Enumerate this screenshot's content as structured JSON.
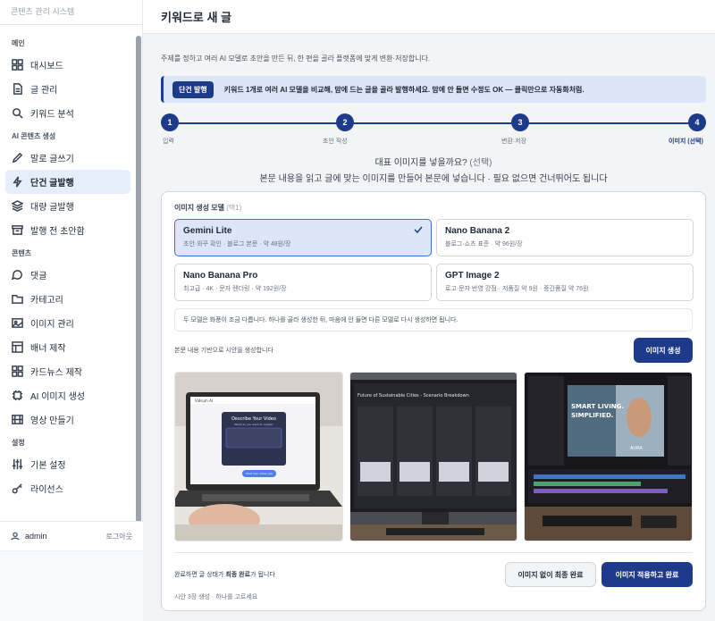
{
  "sidebar": {
    "app_name": "콘텐츠 관리 시스템",
    "sections": [
      {
        "title": "메인",
        "items": [
          {
            "label": "대시보드",
            "icon": "grid-icon"
          },
          {
            "label": "글 관리",
            "icon": "document-icon"
          },
          {
            "label": "키워드 분석",
            "icon": "search-icon"
          }
        ]
      },
      {
        "title": "AI 콘텐츠 생성",
        "items": [
          {
            "label": "말로 글쓰기",
            "icon": "pencil-icon"
          },
          {
            "label": "단건 글발행",
            "icon": "lightning-icon",
            "active": true
          },
          {
            "label": "대량 글발행",
            "icon": "layers-icon"
          },
          {
            "label": "발행 전 초안함",
            "icon": "archive-icon"
          }
        ]
      },
      {
        "title": "콘텐츠",
        "items": [
          {
            "label": "댓글",
            "icon": "chat-icon"
          },
          {
            "label": "카테고리",
            "icon": "folder-icon"
          },
          {
            "label": "이미지 관리",
            "icon": "image-icon"
          },
          {
            "label": "배너 제작",
            "icon": "banner-icon"
          },
          {
            "label": "카드뉴스 제작",
            "icon": "cards-icon"
          },
          {
            "label": "AI 이미지 생성",
            "icon": "chip-icon"
          },
          {
            "label": "영상 만들기",
            "icon": "film-icon"
          }
        ]
      },
      {
        "title": "설정",
        "items": [
          {
            "label": "기본 설정",
            "icon": "sliders-icon"
          },
          {
            "label": "라이선스",
            "icon": "key-icon"
          }
        ]
      }
    ],
    "user": "admin",
    "logout": "로그아웃"
  },
  "header": {
    "title": "키워드로 새 글"
  },
  "intro": "주제를 정하고 여러 AI 모델로 초안을 만든 뒤, 한 편을 골라 플랫폼에 맞게 변환·저장합니다.",
  "banner": {
    "chip": "단건 발행",
    "text": "키워드 1개로 여러 AI 모델을 비교해, 맘에 드는 글을 골라 발행하세요. 맘에 안 들면 수정도 OK — 클릭만으로 자동화처럼."
  },
  "steps": [
    {
      "num": "1",
      "label": "입력"
    },
    {
      "num": "2",
      "label": "초안 작성"
    },
    {
      "num": "3",
      "label": "변환·저장"
    },
    {
      "num": "4",
      "label": "이미지 (선택)"
    }
  ],
  "question": {
    "title": "대표 이미지를 넣을까요?",
    "optional": " (선택)",
    "subtitle": "본문 내용을 읽고 글에 맞는 이미지를 만들어 본문에 넣습니다 · 필요 없으면 건너뛰어도 됩니다"
  },
  "model_section": {
    "label": "이미지 생성 모델",
    "label_hint": " (택1)",
    "models": [
      {
        "name": "Gemini Lite",
        "desc": "초안·와꾸 확인 · 블로그 본문 · 약 48원/장",
        "selected": true
      },
      {
        "name": "Nano Banana 2",
        "desc": "블로그·쇼츠 표준 · 약 96원/장",
        "selected": false
      },
      {
        "name": "Nano Banana Pro",
        "desc": "최고급 · 4K · 문자 렌더링 · 약 192원/장",
        "selected": false
      },
      {
        "name": "GPT Image 2",
        "desc": "로고·문자 반영 강점 · 저품질 약 9원 · 중간품질 약 76원",
        "selected": false
      }
    ],
    "note": "두 모델은 화풍이 조금 다릅니다. 하나를 골라 생성한 뒤, 마음에 안 들면 다른 모델로 다시 생성하면 됩니다."
  },
  "generate": {
    "text": "본문 내용 기반으로 시안을 생성합니다",
    "button": "이미지 생성"
  },
  "thumbnails": {
    "t1": {
      "brand": "Vidsum AI",
      "heading": "Describe Your Video",
      "sub": "What do you want to create?",
      "cta": "Start Your Video (AI)"
    },
    "t2": {
      "heading": "Future of Sustainable Cities - Scenario Breakdown"
    },
    "t3": {
      "line1": "SMART LIVING.",
      "line2": "SIMPLIFIED.",
      "brand": "AURA"
    }
  },
  "final": {
    "text_pre": "완료하면 글 상태가 ",
    "text_bold": "최종 완료",
    "text_post": "가 됩니다",
    "skip_button": "이미지 없이 최종 완료",
    "apply_button": "이미지 적용하고 완료",
    "foot": "시안 3장 생성 · 하나를 고르세요"
  },
  "colors": {
    "accent": "#1e3a8a",
    "selected_bg": "#dbe7f8"
  }
}
